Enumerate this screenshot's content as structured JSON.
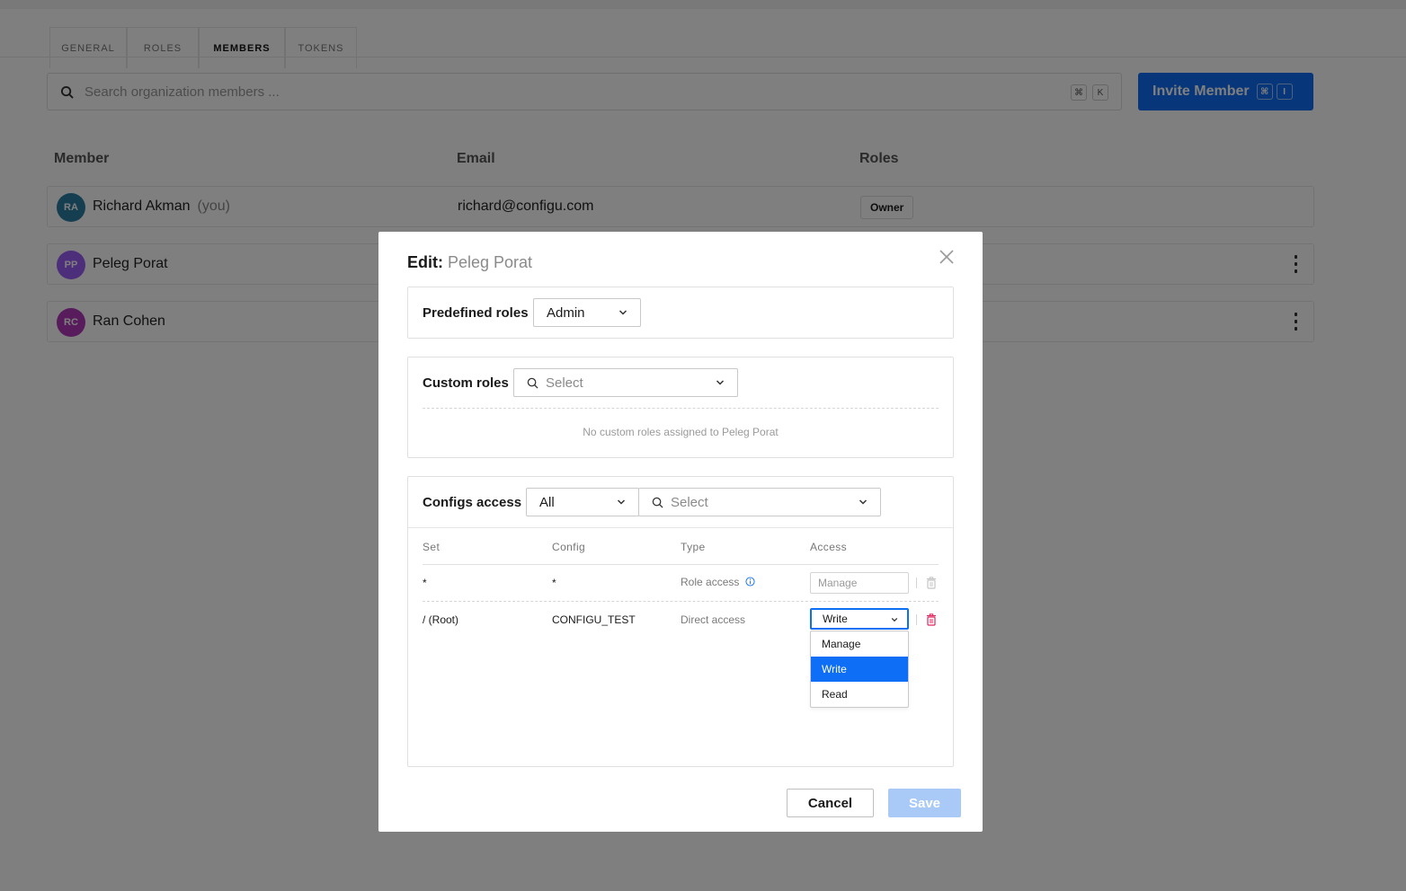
{
  "background": {
    "tabs": [
      {
        "label": "GENERAL"
      },
      {
        "label": "ROLES"
      },
      {
        "label": "MEMBERS",
        "active": true
      },
      {
        "label": "TOKENS"
      }
    ],
    "search_placeholder": "Search organization members ...",
    "search_shortcut": [
      "⌘",
      "K"
    ],
    "invite_button": "Invite Member",
    "invite_shortcut": [
      "⌘",
      "I"
    ],
    "columns": [
      "Member",
      "Email",
      "Roles"
    ],
    "members": [
      {
        "initials": "RA",
        "name": "Richard Akman",
        "you": "(you)",
        "email": "richard@configu.com",
        "role": "Owner",
        "color": "#2a7fa3"
      },
      {
        "initials": "PP",
        "name": "Peleg Porat",
        "color": "#9b5cf6"
      },
      {
        "initials": "RC",
        "name": "Ran Cohen",
        "color": "#b136b8"
      }
    ]
  },
  "modal": {
    "title_prefix": "Edit:",
    "member_name": "Peleg Porat",
    "predefined_roles": {
      "label": "Predefined roles",
      "value": "Admin"
    },
    "custom_roles": {
      "label": "Custom roles",
      "placeholder": "Select",
      "empty_message": "No custom roles assigned to Peleg Porat"
    },
    "configs_access": {
      "label": "Configs access",
      "filter_value": "All",
      "search_placeholder": "Select",
      "columns": [
        "Set",
        "Config",
        "Type",
        "Access"
      ],
      "rows": [
        {
          "set": "*",
          "config": "*",
          "type": "Role access",
          "access": "Manage"
        },
        {
          "set": "/ (Root)",
          "config": "CONFIGU_TEST",
          "type": "Direct access",
          "access": "Write"
        }
      ],
      "dropdown_options": [
        "Manage",
        "Write",
        "Read"
      ],
      "dropdown_selected": "Write"
    },
    "cancel_label": "Cancel",
    "save_label": "Save"
  },
  "colors": {
    "accent": "#0e6ef5",
    "save_disabled": "#a9c9f7",
    "delete_red": "#e0245e",
    "overlay": "rgba(0,0,0,0.5)"
  }
}
